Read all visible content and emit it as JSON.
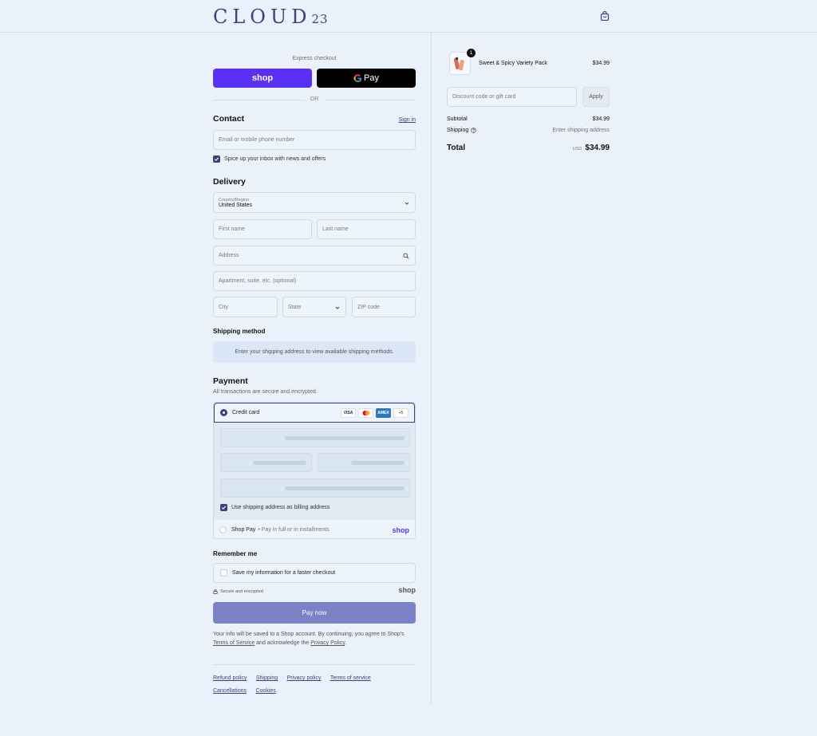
{
  "header": {
    "logo_main": "CLOUD",
    "logo_sub": "23",
    "bag_icon": "shopping-bag-icon"
  },
  "express": {
    "label": "Express checkout",
    "shop_label": "shop",
    "gpay_label": "Pay",
    "or_label": "OR"
  },
  "contact": {
    "title": "Contact",
    "sign_in": "Sign in",
    "email_placeholder": "Email or mobile phone number",
    "newsletter_label": "Spice up your inbox with news and offers",
    "newsletter_checked": true
  },
  "delivery": {
    "title": "Delivery",
    "country_label": "Country/Region",
    "country_value": "United States",
    "first_name": "First name",
    "last_name": "Last name",
    "address": "Address",
    "apartment": "Apartment, suite, etc. (optional)",
    "city": "City",
    "state": "State",
    "zip": "ZIP code"
  },
  "shipping_method": {
    "title": "Shipping method",
    "info": "Enter your shipping address to view available shipping methods."
  },
  "payment": {
    "title": "Payment",
    "subtitle": "All transactions are secure and encrypted.",
    "credit_card_label": "Credit card",
    "card_badges": [
      "VISA",
      "MC",
      "AMEX",
      "+5"
    ],
    "billing_same_label": "Use shipping address as billing address",
    "shop_pay_label": "Shop Pay",
    "shop_pay_sub": "• Pay in full or in installments",
    "shop_logo": "shop"
  },
  "remember": {
    "title": "Remember me",
    "save_label": "Save my information for a faster checkout",
    "secure_label": "Secure and encrypted",
    "shop_logo": "shop"
  },
  "pay_button": "Pay now",
  "legal": {
    "text1": "Your info will be saved to a Shop account. By continuing, you agree to Shop's",
    "terms": "Terms of Service",
    "text2": "and acknowledge the",
    "privacy": "Privacy Policy",
    "end": "."
  },
  "footer_links": [
    "Refund policy",
    "Shipping",
    "Privacy policy",
    "Terms of service",
    "Cancellations",
    "Cookies"
  ],
  "summary": {
    "product_name": "Sweet & Spicy Variety Pack",
    "product_price": "$34.99",
    "quantity": "1",
    "discount_placeholder": "Discount code or gift card",
    "apply_label": "Apply",
    "subtotal_label": "Subtotal",
    "subtotal_value": "$34.99",
    "shipping_label": "Shipping",
    "shipping_value": "Enter shipping address",
    "total_label": "Total",
    "currency": "USD",
    "total_value": "$34.99"
  },
  "colors": {
    "background": "#eaf1fa",
    "accent": "#3d4377",
    "shop_purple": "#5a31f4",
    "pay_button": "#7b82c5"
  }
}
